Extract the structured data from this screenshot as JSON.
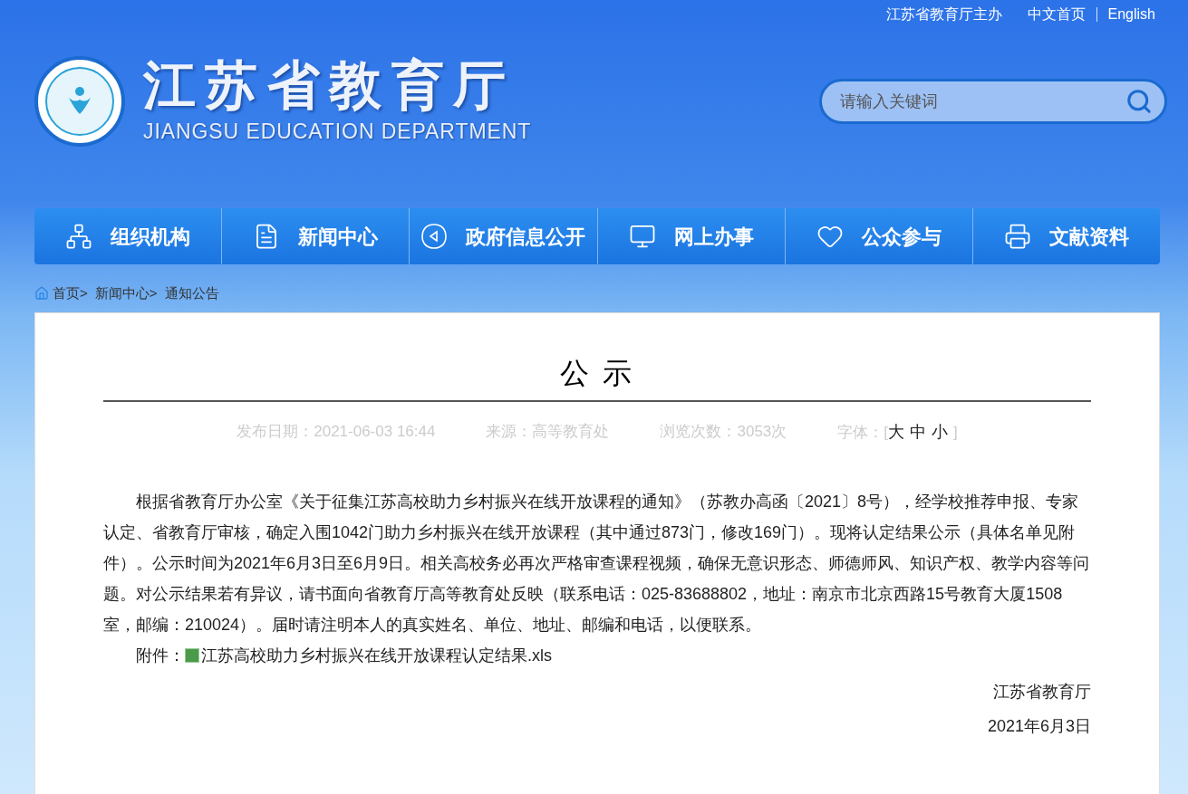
{
  "top_links": {
    "sponsor": "江苏省教育厅主办",
    "links": [
      "中文首页",
      "English"
    ]
  },
  "logo": {
    "title": "江苏省教育厅",
    "subtitle": "JIANGSU EDUCATION DEPARTMENT"
  },
  "search": {
    "placeholder": "请输入关键词"
  },
  "nav": [
    {
      "label": "组织机构"
    },
    {
      "label": "新闻中心"
    },
    {
      "label": "政府信息公开"
    },
    {
      "label": "网上办事"
    },
    {
      "label": "公众参与"
    },
    {
      "label": "文献资料"
    }
  ],
  "breadcrumb": [
    "首页>",
    "新闻中心>",
    "通知公告"
  ],
  "article": {
    "title": "公 示",
    "meta": [
      "发布日期：2021-06-03 16:44",
      "来源：高等教育处",
      "浏览次数：3053次"
    ],
    "font_size": {
      "label": "字体：[",
      "options": [
        "大",
        "中",
        "小"
      ],
      "close": "]"
    },
    "body": "根据省教育厅办公室《关于征集江苏高校助力乡村振兴在线开放课程的通知》（苏教办高函〔2021〕8号），经学校推荐申报、专家认定、省教育厅审核，确定入围1042门助力乡村振兴在线开放课程（其中通过873门，修改169门）。现将认定结果公示（具体名单见附件）。公示时间为2021年6月3日至6月9日。相关高校务必再次严格审查课程视频，确保无意识形态、师德师风、知识产权、教学内容等问题。对公示结果若有异议，请书面向省教育厅高等教育处反映（联系电话：025-83688802，地址：南京市北京西路15号教育大厦1508室，邮编：210024）。届时请注明本人的真实姓名、单位、地址、邮编和电话，以便联系。",
    "attachment": {
      "label": "附件：",
      "file": "江苏高校助力乡村振兴在线开放课程认定结果.xls"
    },
    "signature": [
      "江苏省教育厅",
      "2021年6月3日"
    ]
  }
}
